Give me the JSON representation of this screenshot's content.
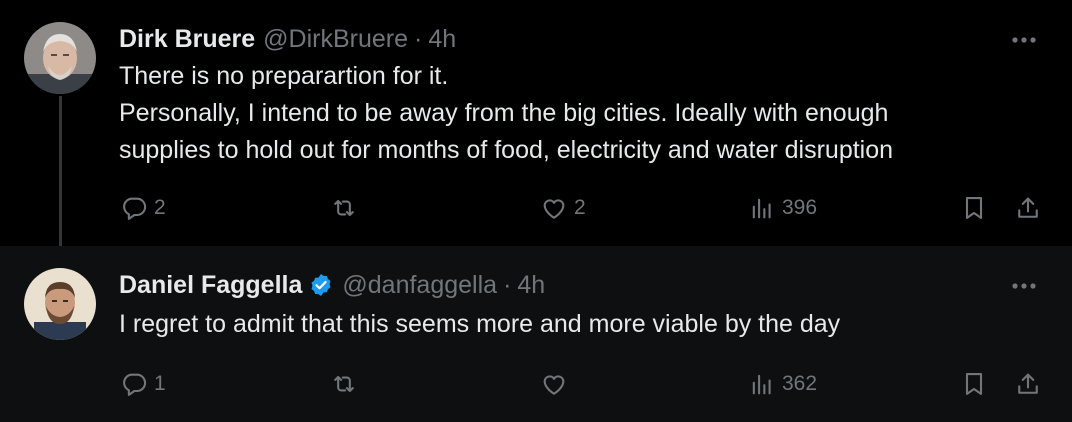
{
  "colors": {
    "background": "#000000",
    "reply_background": "#0e0f10",
    "text_primary": "#e7e9ea",
    "text_secondary": "#71767b",
    "verified": "#1d9bf0"
  },
  "tweets": [
    {
      "display_name": "Dirk Bruere",
      "handle": "@DirkBruere",
      "separator": "·",
      "time": "4h",
      "verified": false,
      "avatar": "avatar-older-man-icon",
      "lines": [
        "There is no preparartion for it.",
        "Personally, I intend to be away from the big cities. Ideally with enough",
        "supplies to hold out for months of food, electricity and water disruption"
      ],
      "stats": {
        "replies": "2",
        "retweets": "",
        "likes": "2",
        "views": "396"
      }
    },
    {
      "display_name": "Daniel Faggella",
      "handle": "@danfaggella",
      "separator": "·",
      "time": "4h",
      "verified": true,
      "avatar": "avatar-bearded-man-icon",
      "lines": [
        "I regret to admit that this seems more and more viable by the day"
      ],
      "stats": {
        "replies": "1",
        "retweets": "",
        "likes": "",
        "views": "362"
      }
    }
  ]
}
